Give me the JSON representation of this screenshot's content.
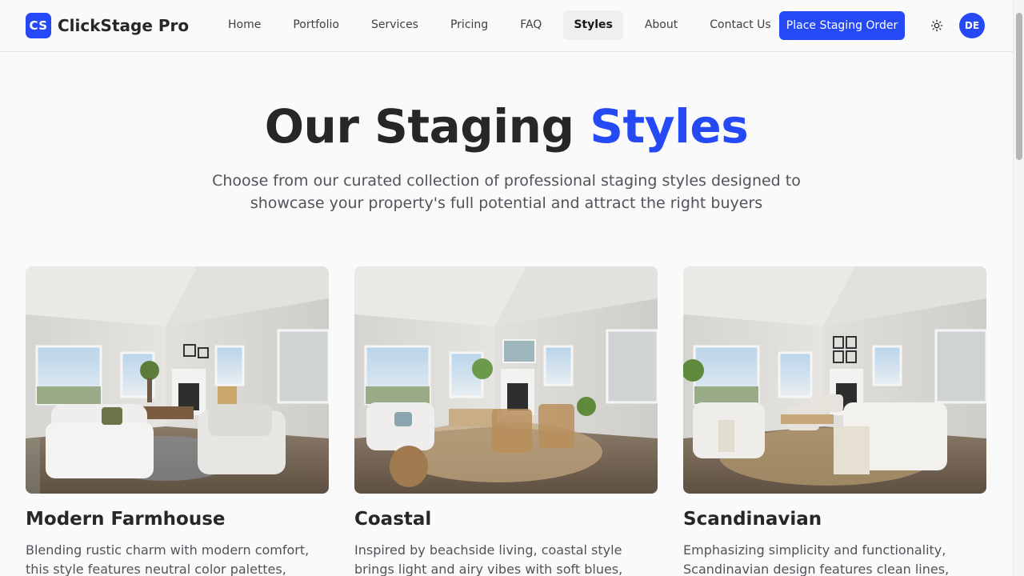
{
  "brand": {
    "logo_text": "CS",
    "name": "ClickStage Pro"
  },
  "nav": {
    "items": [
      {
        "label": "Home",
        "active": false
      },
      {
        "label": "Portfolio",
        "active": false
      },
      {
        "label": "Services",
        "active": false
      },
      {
        "label": "Pricing",
        "active": false
      },
      {
        "label": "FAQ",
        "active": false
      },
      {
        "label": "Styles",
        "active": true
      },
      {
        "label": "About",
        "active": false
      },
      {
        "label": "Contact Us",
        "active": false
      }
    ],
    "cta_label": "Place Staging Order",
    "theme_icon": "sun-icon",
    "avatar_initials": "DE"
  },
  "hero": {
    "title_prefix": "Our Staging",
    "title_accent": "Styles",
    "subtitle": "Choose from our curated collection of professional staging styles designed to showcase your property's full potential and attract the right buyers"
  },
  "styles": [
    {
      "name": "Modern Farmhouse",
      "description": "Blending rustic charm with modern comfort, this style features neutral color palettes, natural wood"
    },
    {
      "name": "Coastal",
      "description": "Inspired by beachside living, coastal style brings light and airy vibes with soft blues, sandy neutrals"
    },
    {
      "name": "Scandinavian",
      "description": "Emphasizing simplicity and functionality, Scandinavian design features clean lines, minimal"
    }
  ],
  "colors": {
    "accent": "#2449f5",
    "text": "#27272a",
    "muted": "#52525b",
    "background": "#fafafa"
  }
}
